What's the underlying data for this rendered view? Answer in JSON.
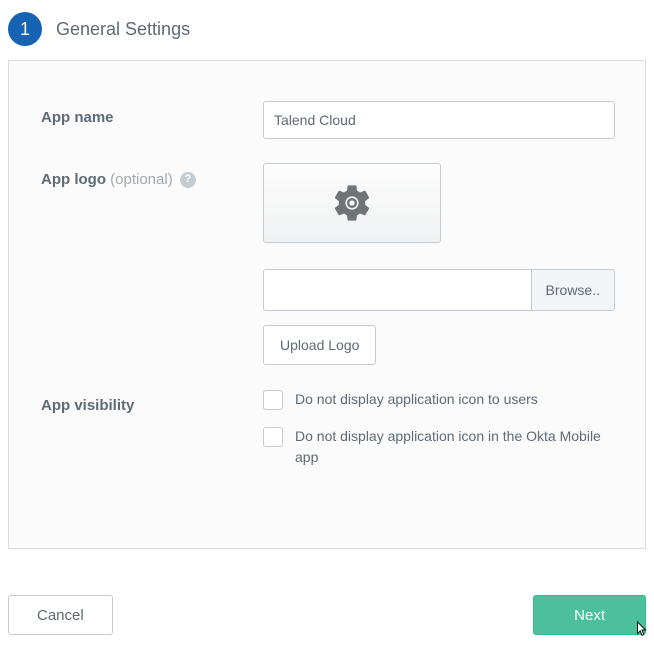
{
  "step": {
    "number": "1",
    "title": "General Settings"
  },
  "form": {
    "appName": {
      "label": "App name",
      "value": "Talend Cloud"
    },
    "appLogo": {
      "label": "App logo",
      "optional": "(optional)",
      "browseLabel": "Browse..",
      "uploadLabel": "Upload Logo",
      "filePath": ""
    },
    "visibility": {
      "label": "App visibility",
      "option1": "Do not display application icon to users",
      "option2": "Do not display application icon in the Okta Mobile app"
    }
  },
  "footer": {
    "cancel": "Cancel",
    "next": "Next"
  }
}
